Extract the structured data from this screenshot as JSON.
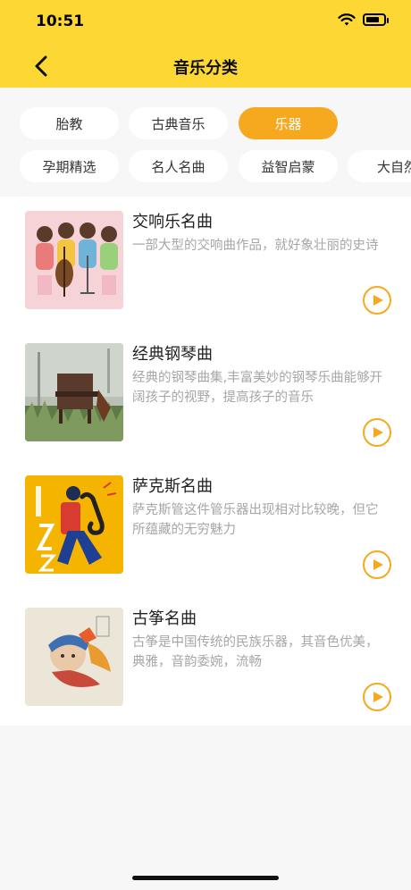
{
  "status": {
    "time": "10:51"
  },
  "header": {
    "title": "音乐分类"
  },
  "categories": [
    {
      "label": "胎教",
      "active": false
    },
    {
      "label": "古典音乐",
      "active": false
    },
    {
      "label": "乐器",
      "active": true
    },
    {
      "label": "孕期精选",
      "active": false
    },
    {
      "label": "名人名曲",
      "active": false
    },
    {
      "label": "益智启蒙",
      "active": false
    },
    {
      "label": "大自然",
      "active": false
    }
  ],
  "items": [
    {
      "name": "交响乐名曲",
      "desc": "一部大型的交响曲作品，就好象壮丽的史诗"
    },
    {
      "name": "经典钢琴曲",
      "desc": "经典的钢琴曲集,丰富美妙的钢琴乐曲能够开阔孩子的视野，提高孩子的音乐"
    },
    {
      "name": "萨克斯名曲",
      "desc": "萨克斯管这件管乐器出现相对比较晚，但它所蕴藏的无穷魅力"
    },
    {
      "name": "古筝名曲",
      "desc": "古筝是中国传统的民族乐器，其音色优美，典雅，音韵委婉，流畅"
    }
  ],
  "colors": {
    "accent": "#f6a91f",
    "header_bg": "#fdd835"
  },
  "icons": [
    "back-icon",
    "wifi-icon",
    "battery-icon",
    "play-icon"
  ]
}
